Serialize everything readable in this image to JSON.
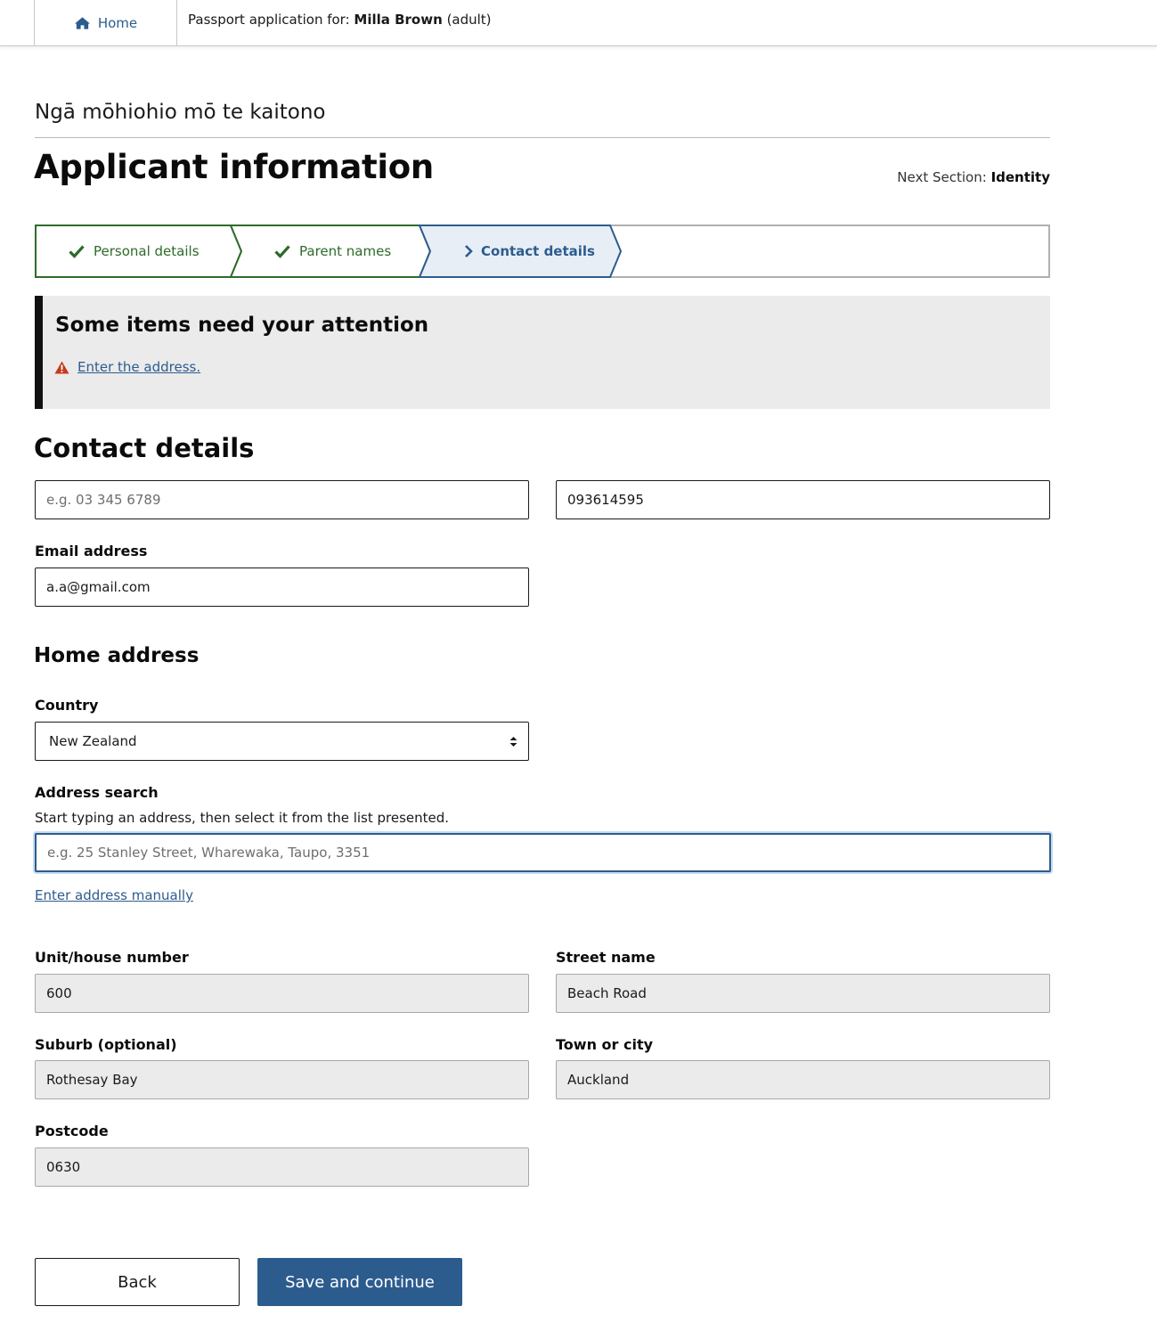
{
  "header": {
    "home_label": "Home",
    "application_prefix": "Passport application for: ",
    "applicant_name": "Milla Brown",
    "applicant_type": "(adult)"
  },
  "page": {
    "maori_title": "Ngā mōhiohio mō te kaitono",
    "title": "Applicant information",
    "next_section_prefix": "Next Section: ",
    "next_section": "Identity"
  },
  "stepper": {
    "steps": [
      {
        "label": "Personal details",
        "status": "complete"
      },
      {
        "label": "Parent names",
        "status": "complete"
      },
      {
        "label": "Contact details",
        "status": "current"
      }
    ]
  },
  "alert": {
    "title": "Some items need your attention",
    "items": [
      "Enter the address."
    ]
  },
  "contact": {
    "title": "Contact details",
    "phone_placeholder": "e.g. 03 345 6789",
    "phone_value": "",
    "phone2_value": "093614595",
    "email_label": "Email address",
    "email_value": "a.a@gmail.com"
  },
  "address": {
    "title": "Home address",
    "country_label": "Country",
    "country_value": "New Zealand",
    "search_label": "Address search",
    "search_hint": "Start typing an address, then select it from the list presented.",
    "search_placeholder": "e.g. 25 Stanley Street, Wharewaka, Taupo, 3351",
    "manual_link": "Enter address manually",
    "unit_label": "Unit/house number",
    "unit_value": "600",
    "street_label": "Street name",
    "street_value": "Beach Road",
    "suburb_label": "Suburb (optional)",
    "suburb_value": "Rothesay Bay",
    "town_label": "Town or city",
    "town_value": "Auckland",
    "postcode_label": "Postcode",
    "postcode_value": "0630"
  },
  "actions": {
    "back_label": "Back",
    "save_label": "Save and continue"
  },
  "colors": {
    "accent": "#2c5c8e",
    "success": "#2e6b2a",
    "warning": "#c43c1b",
    "alert_bg": "#ebebeb"
  }
}
